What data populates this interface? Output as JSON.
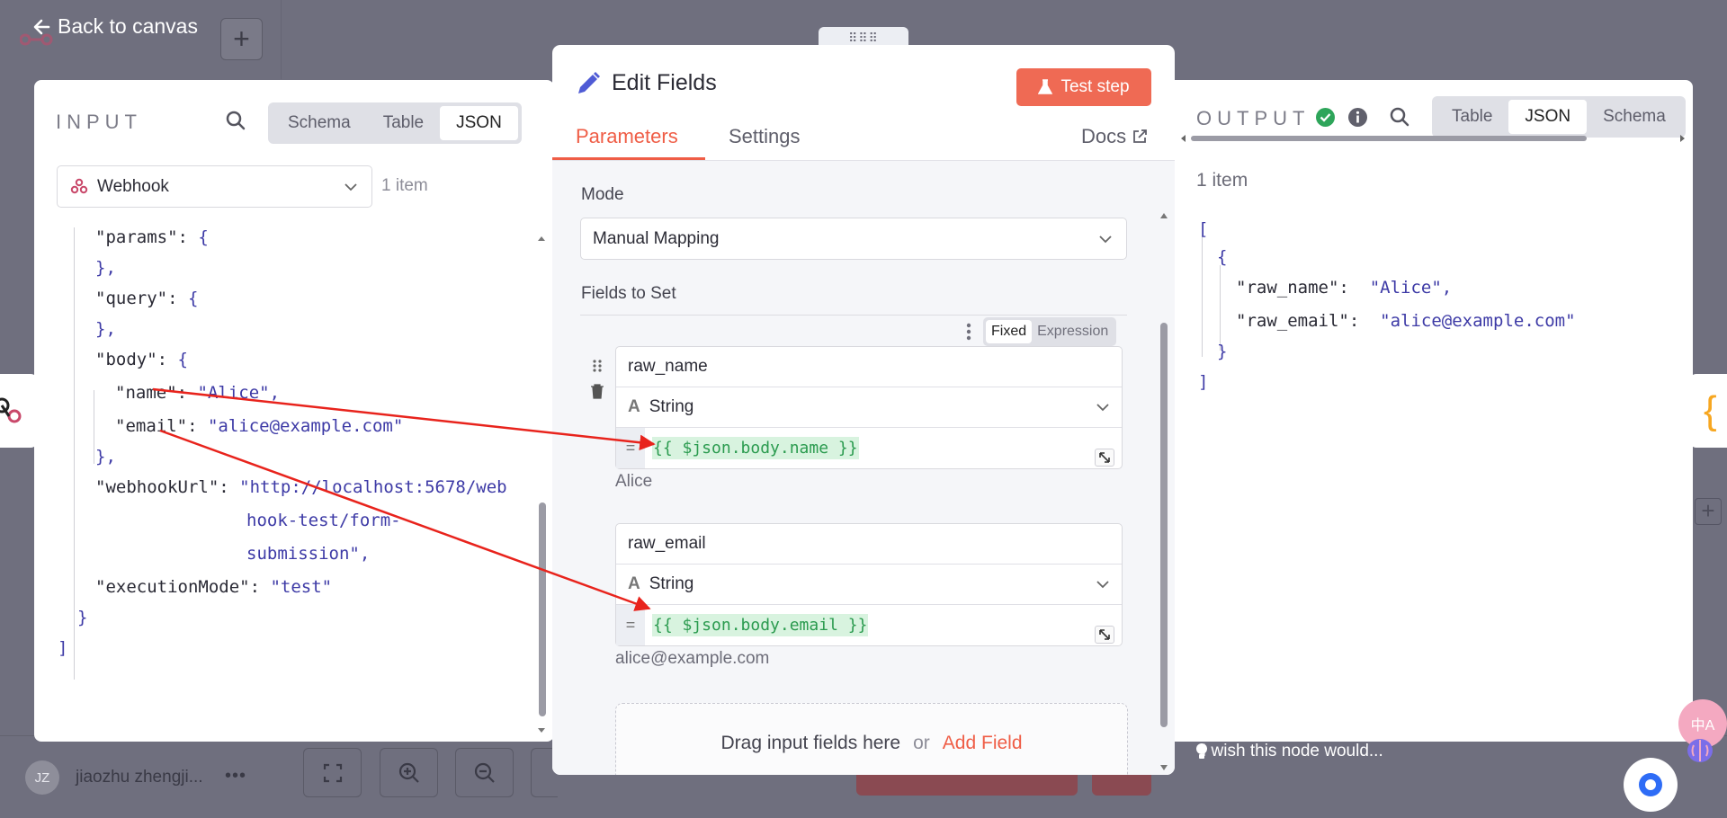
{
  "nav": {
    "back_label": "Back to canvas"
  },
  "input_panel": {
    "title": "INPUT",
    "tabs": [
      "Schema",
      "Table",
      "JSON"
    ],
    "active_tab": "JSON",
    "node_name": "Webhook",
    "item_count": "1 item"
  },
  "input_json": {
    "params_key": "\"params\"",
    "params_open": "{",
    "params_close": "},",
    "query_key": "\"query\"",
    "query_open": "{",
    "query_close": "},",
    "body_key": "\"body\"",
    "body_open": "{",
    "name_key": "\"name\"",
    "name_val": "\"Alice\",",
    "email_key": "\"email\"",
    "email_val": "\"alice@example.com\"",
    "body_close": "},",
    "webhook_key": "\"webhookUrl\"",
    "webhook_val_1": "\"http://localhost:5678/web",
    "webhook_val_2": "hook-test/form-",
    "webhook_val_3": "submission\",",
    "mode_key": "\"executionMode\"",
    "mode_val": "\"test\"",
    "outer_close": "}",
    "array_close": "]"
  },
  "dialog": {
    "title": "Edit Fields",
    "test_step_label": "Test step",
    "tabs": [
      "Parameters",
      "Settings"
    ],
    "docs_label": "Docs",
    "mode_label": "Mode",
    "mode_value": "Manual Mapping",
    "fields_label": "Fields to Set",
    "toggle": [
      "Fixed",
      "Expression"
    ],
    "toggle_active": "Fixed",
    "fields": [
      {
        "name": "raw_name",
        "type": "String",
        "expression": "{{ $json.body.name }}",
        "result": "Alice"
      },
      {
        "name": "raw_email",
        "type": "String",
        "expression": "{{ $json.body.email }}",
        "result": "alice@example.com"
      }
    ],
    "drop_text": "Drag input fields here",
    "drop_or": "or",
    "add_field_label": "Add Field"
  },
  "output_panel": {
    "title": "OUTPUT",
    "tabs": [
      "Table",
      "JSON",
      "Schema"
    ],
    "active_tab": "JSON",
    "item_count": "1 item"
  },
  "output_json": {
    "open_bracket": "[",
    "open_brace": "{",
    "raw_name_key": "\"raw_name\"",
    "raw_name_val": "\"Alice\",",
    "raw_email_key": "\"raw_email\"",
    "raw_email_val": "\"alice@example.com\"",
    "close_brace": "}",
    "close_bracket": "]"
  },
  "footer": {
    "help_text": "I wish this node would...",
    "user_initials": "JZ",
    "user_name": "jiaozhu zhengji...",
    "translate_badge": "中A"
  },
  "colors": {
    "accent": "#ef5d46",
    "expression_bg": "#d8f3df",
    "expression_text": "#2b9b4f",
    "json_string": "#3d3aa6",
    "annotation_arrow": "#e8231c"
  }
}
